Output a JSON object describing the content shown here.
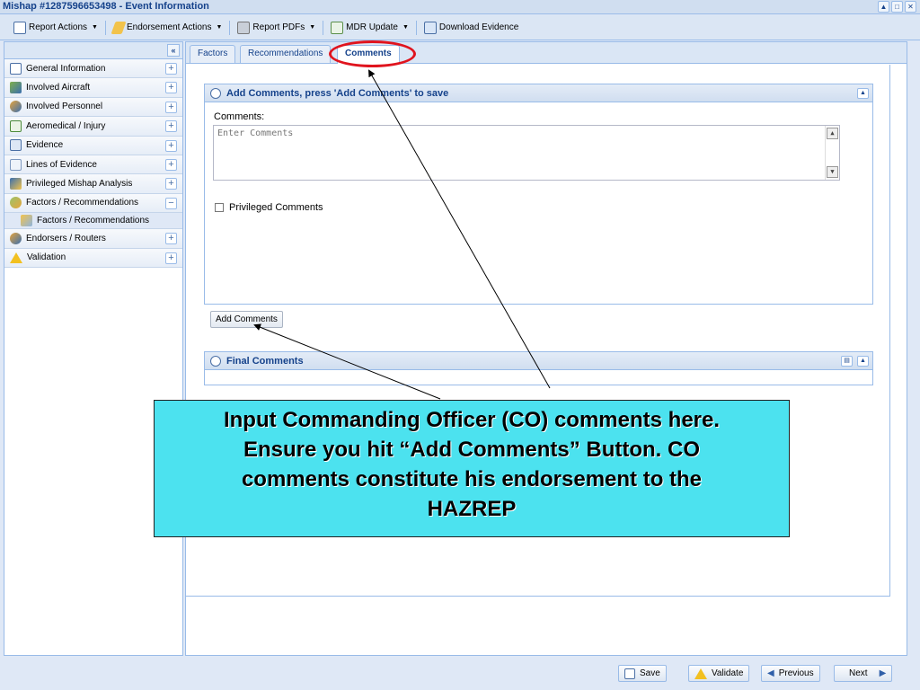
{
  "window": {
    "title": "Mishap #1287596653498 - Event Information"
  },
  "toolbar": {
    "report_actions": "Report Actions",
    "endorsement_actions": "Endorsement Actions",
    "report_pdfs": "Report PDFs",
    "mdr_update": "MDR Update",
    "download_evidence": "Download Evidence"
  },
  "sidebar": {
    "collapse_glyph": "«",
    "items": [
      {
        "label": "General Information",
        "icon": "document-icon",
        "toggle": "+"
      },
      {
        "label": "Involved Aircraft",
        "icon": "aircraft-icon",
        "toggle": "+"
      },
      {
        "label": "Involved Personnel",
        "icon": "people-icon",
        "toggle": "+"
      },
      {
        "label": "Aeromedical / Injury",
        "icon": "medical-icon",
        "toggle": "+"
      },
      {
        "label": "Evidence",
        "icon": "evidence-icon",
        "toggle": "+"
      },
      {
        "label": "Lines of Evidence",
        "icon": "lines-icon",
        "toggle": "+"
      },
      {
        "label": "Privileged Mishap Analysis",
        "icon": "analysis-icon",
        "toggle": "+"
      },
      {
        "label": "Factors / Recommendations",
        "icon": "factors-icon",
        "toggle": "−"
      },
      {
        "label": "Endorsers / Routers",
        "icon": "endorsers-icon",
        "toggle": "+"
      },
      {
        "label": "Validation",
        "icon": "warning-icon",
        "toggle": "+"
      }
    ],
    "sub_item": "Factors / Recommendations"
  },
  "tabs": [
    "Factors",
    "Recommendations",
    "Comments"
  ],
  "add_panel": {
    "title": "Add Comments, press 'Add Comments' to save",
    "comments_label": "Comments:",
    "comments_placeholder": "Enter Comments",
    "privileged_label": "Privileged Comments",
    "add_button": "Add Comments"
  },
  "final_panel": {
    "title": "Final Comments"
  },
  "callout": {
    "line1": "Input Commanding Officer (CO) comments here.",
    "line2": "Ensure you hit “Add Comments” Button.  CO",
    "line3": "comments constitute his endorsement to the",
    "line4": "HAZREP"
  },
  "footer": {
    "save": "Save",
    "validate": "Validate",
    "previous": "Previous",
    "next": "Next"
  },
  "colors": {
    "header_text": "#15428b",
    "callout_bg": "#4ce2ef",
    "highlight_ring": "#e0141e"
  }
}
